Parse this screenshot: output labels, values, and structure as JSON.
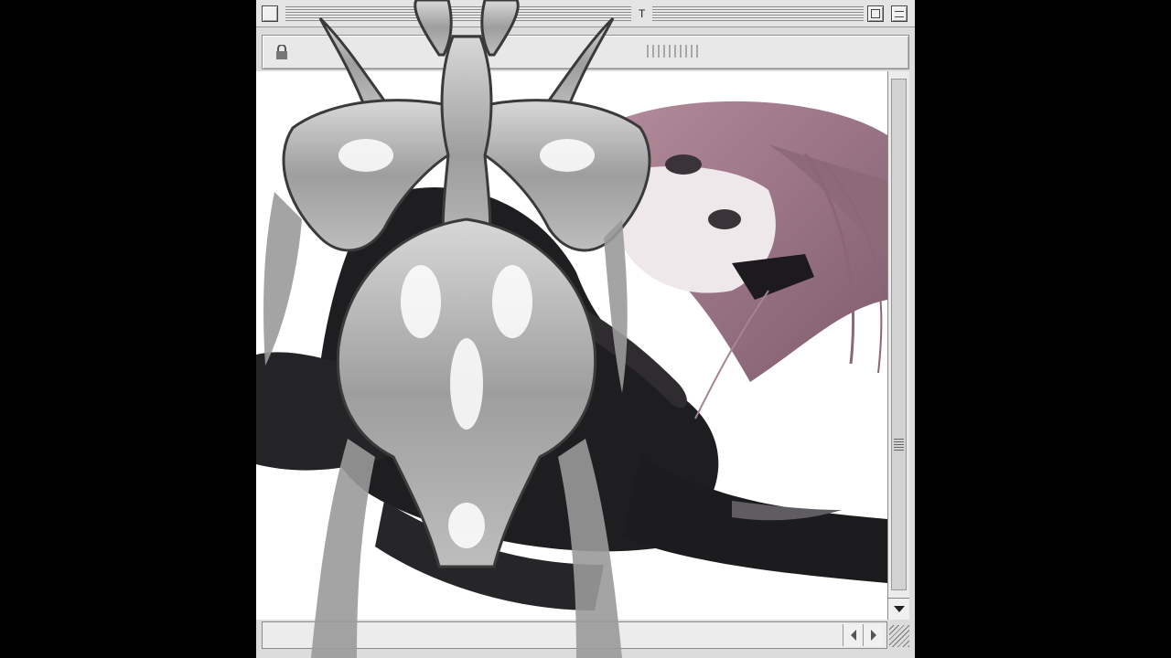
{
  "window": {
    "title": "",
    "title_mark": "T"
  },
  "icons": {
    "close": "close-box-icon",
    "zoom": "zoom-box-icon",
    "collapse": "collapse-box-icon",
    "lock": "lock-icon",
    "scroll_down": "arrow-down-icon",
    "scroll_left": "arrow-left-icon",
    "scroll_right": "arrow-right-icon",
    "resize": "resize-grip-icon"
  },
  "colors": {
    "window_chrome": "#dcdcdc",
    "content_bg": "#ffffff",
    "outer_bg": "#000000",
    "hair": "#9a6f80",
    "emblem": "#b5b5b5"
  }
}
